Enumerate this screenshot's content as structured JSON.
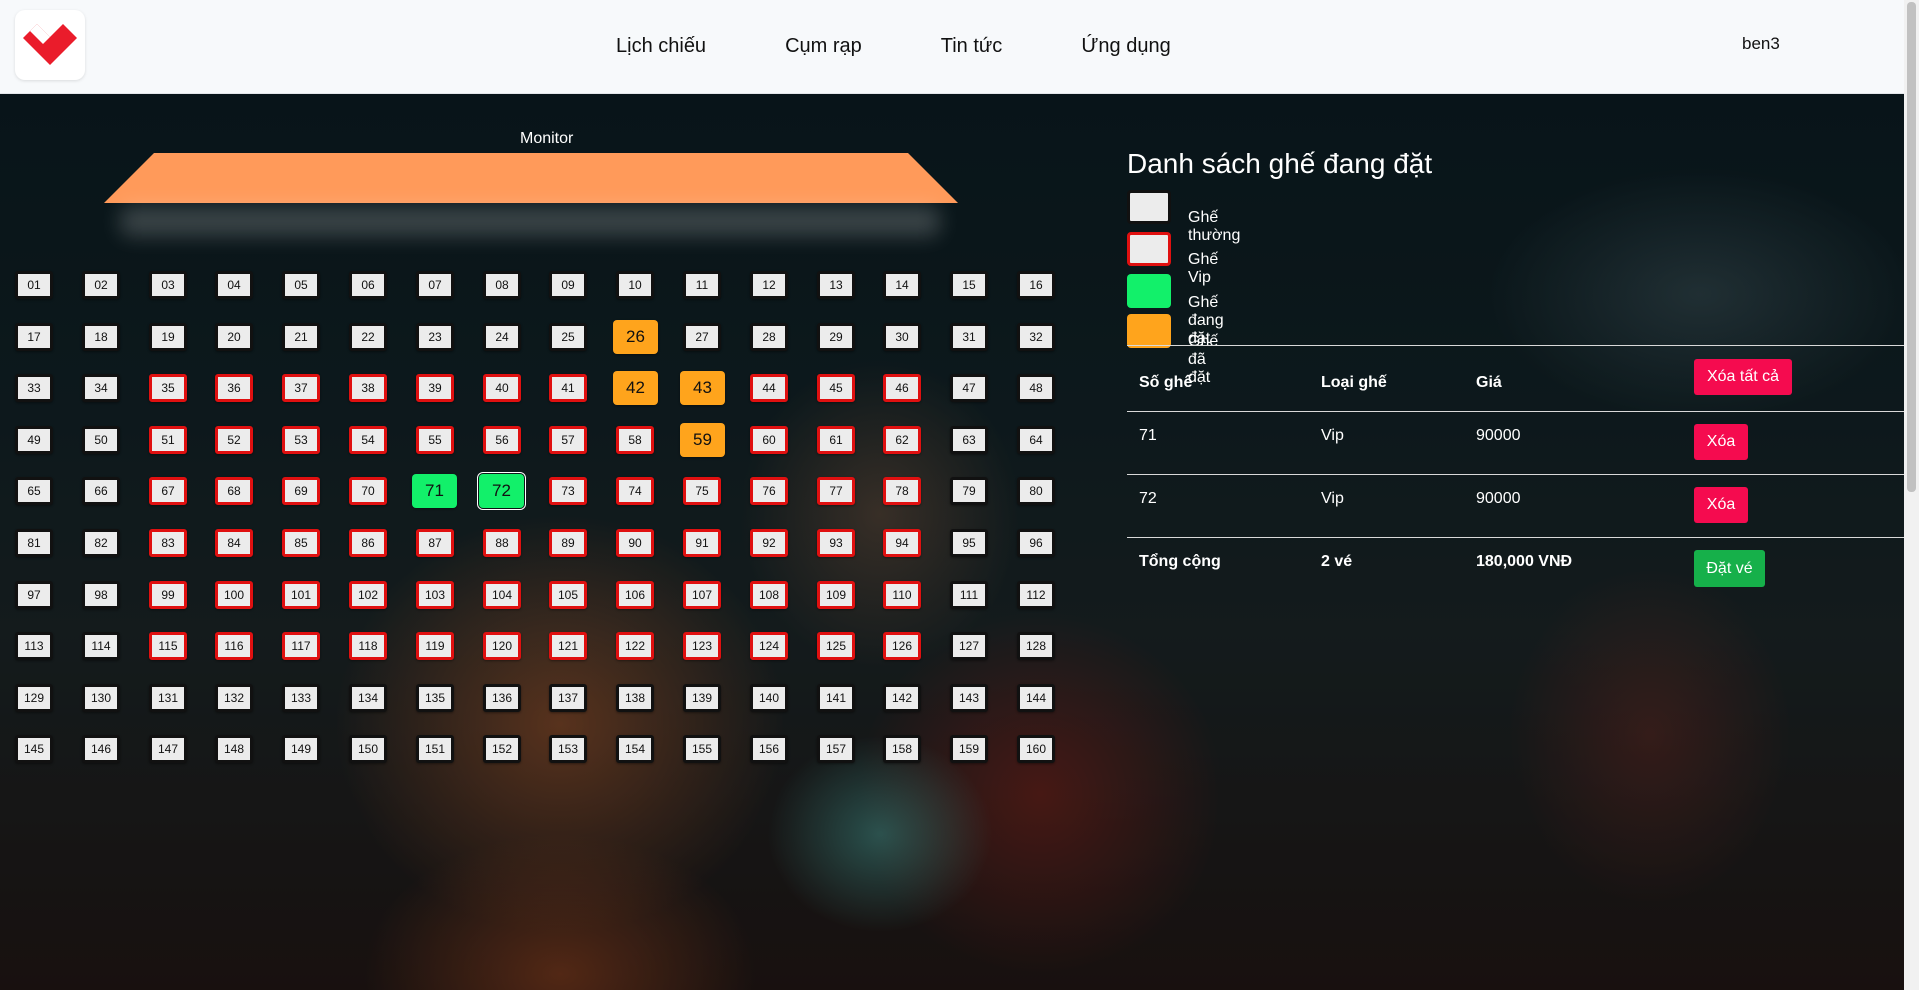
{
  "header": {
    "nav": [
      "Lịch chiếu",
      "Cụm rạp",
      "Tin tức",
      "Ứng dụng"
    ],
    "user": "ben3",
    "logo_icon": "heart-logo-icon"
  },
  "screen": {
    "label": "Monitor"
  },
  "seating": {
    "rows": 10,
    "cols": 16,
    "vip_rows": [
      3,
      4,
      5,
      6,
      7,
      8
    ],
    "vip_cols": [
      3,
      4,
      5,
      6,
      7,
      8,
      9,
      10,
      11,
      12,
      13,
      14
    ],
    "reserved": [
      26,
      42,
      43,
      59
    ],
    "selected": [
      71,
      72
    ],
    "colors": {
      "normal": "#ececec",
      "vip_border": "#e01010",
      "selected": "#12f06a",
      "reserved": "#ffa41c"
    }
  },
  "panel": {
    "title": "Danh sách ghế đang đặt",
    "legend": [
      {
        "label": "Ghế thường",
        "type": "normal"
      },
      {
        "label": "Ghế Vip",
        "type": "vip"
      },
      {
        "label": "Ghế đang đặt",
        "type": "selected"
      },
      {
        "label": "Ghế đã đặt",
        "type": "reserved"
      }
    ],
    "table": {
      "headers": [
        "Số ghế",
        "Loại ghế",
        "Giá"
      ],
      "clear_all": "Xóa tất cả",
      "rows": [
        {
          "seat": "71",
          "type": "Vip",
          "price": "90000",
          "action": "Xóa"
        },
        {
          "seat": "72",
          "type": "Vip",
          "price": "90000",
          "action": "Xóa"
        }
      ],
      "total": {
        "label": "Tổng cộng",
        "count": "2 vé",
        "amount": "180,000 VNĐ",
        "action": "Đặt vé"
      }
    }
  }
}
